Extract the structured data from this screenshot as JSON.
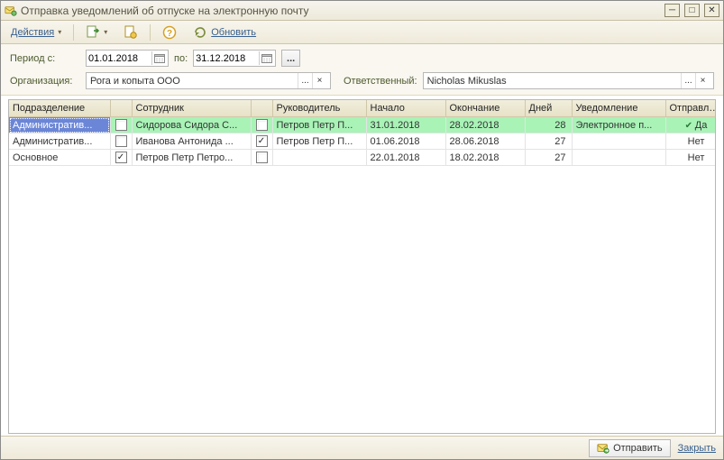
{
  "window": {
    "title": "Отправка уведомлений об отпуске на электронную почту"
  },
  "toolbar": {
    "actions_label": "Действия",
    "refresh_label": "Обновить"
  },
  "form": {
    "period_label": "Период с:",
    "period_to_label": "по:",
    "period_from": "01.01.2018",
    "period_to": "31.12.2018",
    "org_label": "Организация:",
    "org_value": "Рога и копыта ООО",
    "resp_label": "Ответственный:",
    "resp_value": "Nicholas Mikuslas"
  },
  "grid": {
    "headers": {
      "dept": "Подразделение",
      "chk1": "",
      "employee": "Сотрудник",
      "chk2": "",
      "manager": "Руководитель",
      "start": "Начало",
      "end": "Окончание",
      "days": "Дней",
      "notif": "Уведомление",
      "sent": "Отправлено"
    },
    "rows": [
      {
        "selected": true,
        "dept": "Административ...",
        "chk1": false,
        "employee": "Сидорова Сидора С...",
        "chk2": false,
        "manager": "Петров Петр П...",
        "start": "31.01.2018",
        "end": "28.02.2018",
        "days": "28",
        "notif": "Электронное п...",
        "sent": "Да",
        "sent_ok": true
      },
      {
        "selected": false,
        "dept": "Административ...",
        "chk1": false,
        "employee": "Иванова Антонида ...",
        "chk2": true,
        "manager": "Петров Петр П...",
        "start": "01.06.2018",
        "end": "28.06.2018",
        "days": "27",
        "notif": "",
        "sent": "Нет",
        "sent_ok": false
      },
      {
        "selected": false,
        "dept": "Основное",
        "chk1": true,
        "employee": "Петров Петр Петро...",
        "chk2": false,
        "manager": "",
        "start": "22.01.2018",
        "end": "18.02.2018",
        "days": "27",
        "notif": "",
        "sent": "Нет",
        "sent_ok": false
      }
    ]
  },
  "footer": {
    "send_label": "Отправить",
    "close_label": "Закрыть"
  }
}
